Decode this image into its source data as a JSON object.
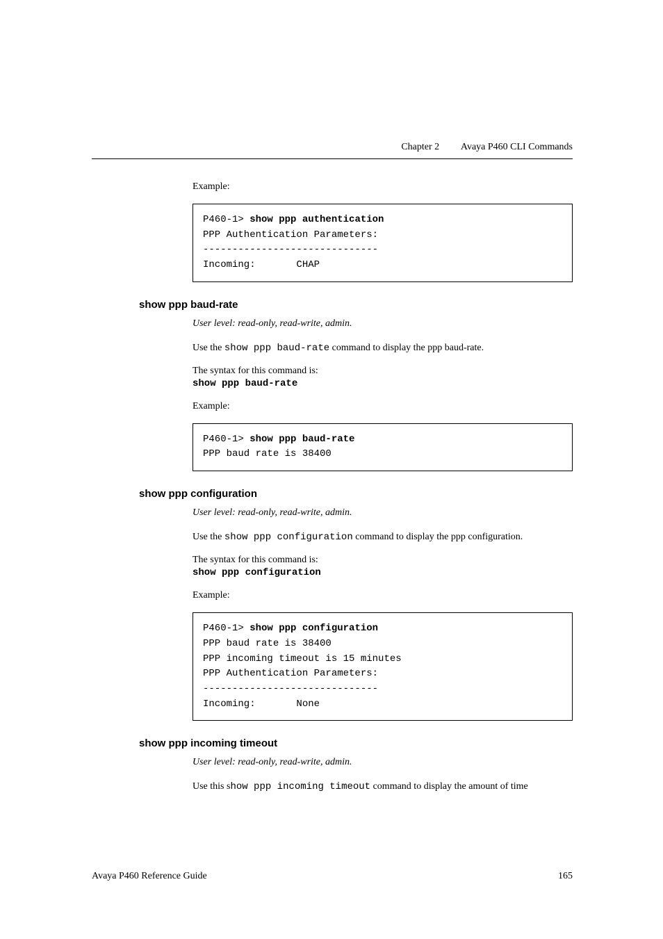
{
  "header": {
    "chapter_label": "Chapter 2",
    "chapter_title": "Avaya P460 CLI Commands"
  },
  "section_auth_example": {
    "example_label": "Example:",
    "code_prompt": "P460-1> ",
    "code_command": "show ppp authentication",
    "code_lines": "\nPPP Authentication Parameters:\n------------------------------\nIncoming:       CHAP"
  },
  "section_baud": {
    "heading": "show ppp baud-rate",
    "user_level": "User level: read-only, read-write, admin.",
    "use_prefix": "Use the ",
    "use_cmd": "show ppp baud-rate",
    "use_suffix": " command to display the ppp baud-rate.",
    "syntax_label": "The syntax for this command is:",
    "syntax_cmd": "show ppp baud-rate",
    "example_label": "Example:",
    "code_prompt": "P460-1> ",
    "code_command": "show ppp baud-rate",
    "code_lines": "\nPPP baud rate is 38400"
  },
  "section_config": {
    "heading": "show ppp configuration",
    "user_level": "User level: read-only, read-write, admin.",
    "use_prefix": "Use the ",
    "use_cmd": "show ppp configuration",
    "use_suffix": " command to display the ppp configuration.",
    "syntax_label": "The syntax for this command is:",
    "syntax_cmd": "show ppp configuration",
    "example_label": "Example:",
    "code_prompt": "P460-1> ",
    "code_command": "show ppp configuration",
    "code_lines": "\nPPP baud rate is 38400\nPPP incoming timeout is 15 minutes\nPPP Authentication Parameters:\n------------------------------\nIncoming:       None"
  },
  "section_timeout": {
    "heading": "show ppp incoming timeout",
    "user_level": "User level: read-only, read-write, admin.",
    "use_prefix": "Use this s",
    "use_cmd": "how ppp incoming timeout",
    "use_suffix": " command to display the amount of time"
  },
  "footer": {
    "doc_title": "Avaya P460 Reference Guide",
    "page_number": "165"
  }
}
